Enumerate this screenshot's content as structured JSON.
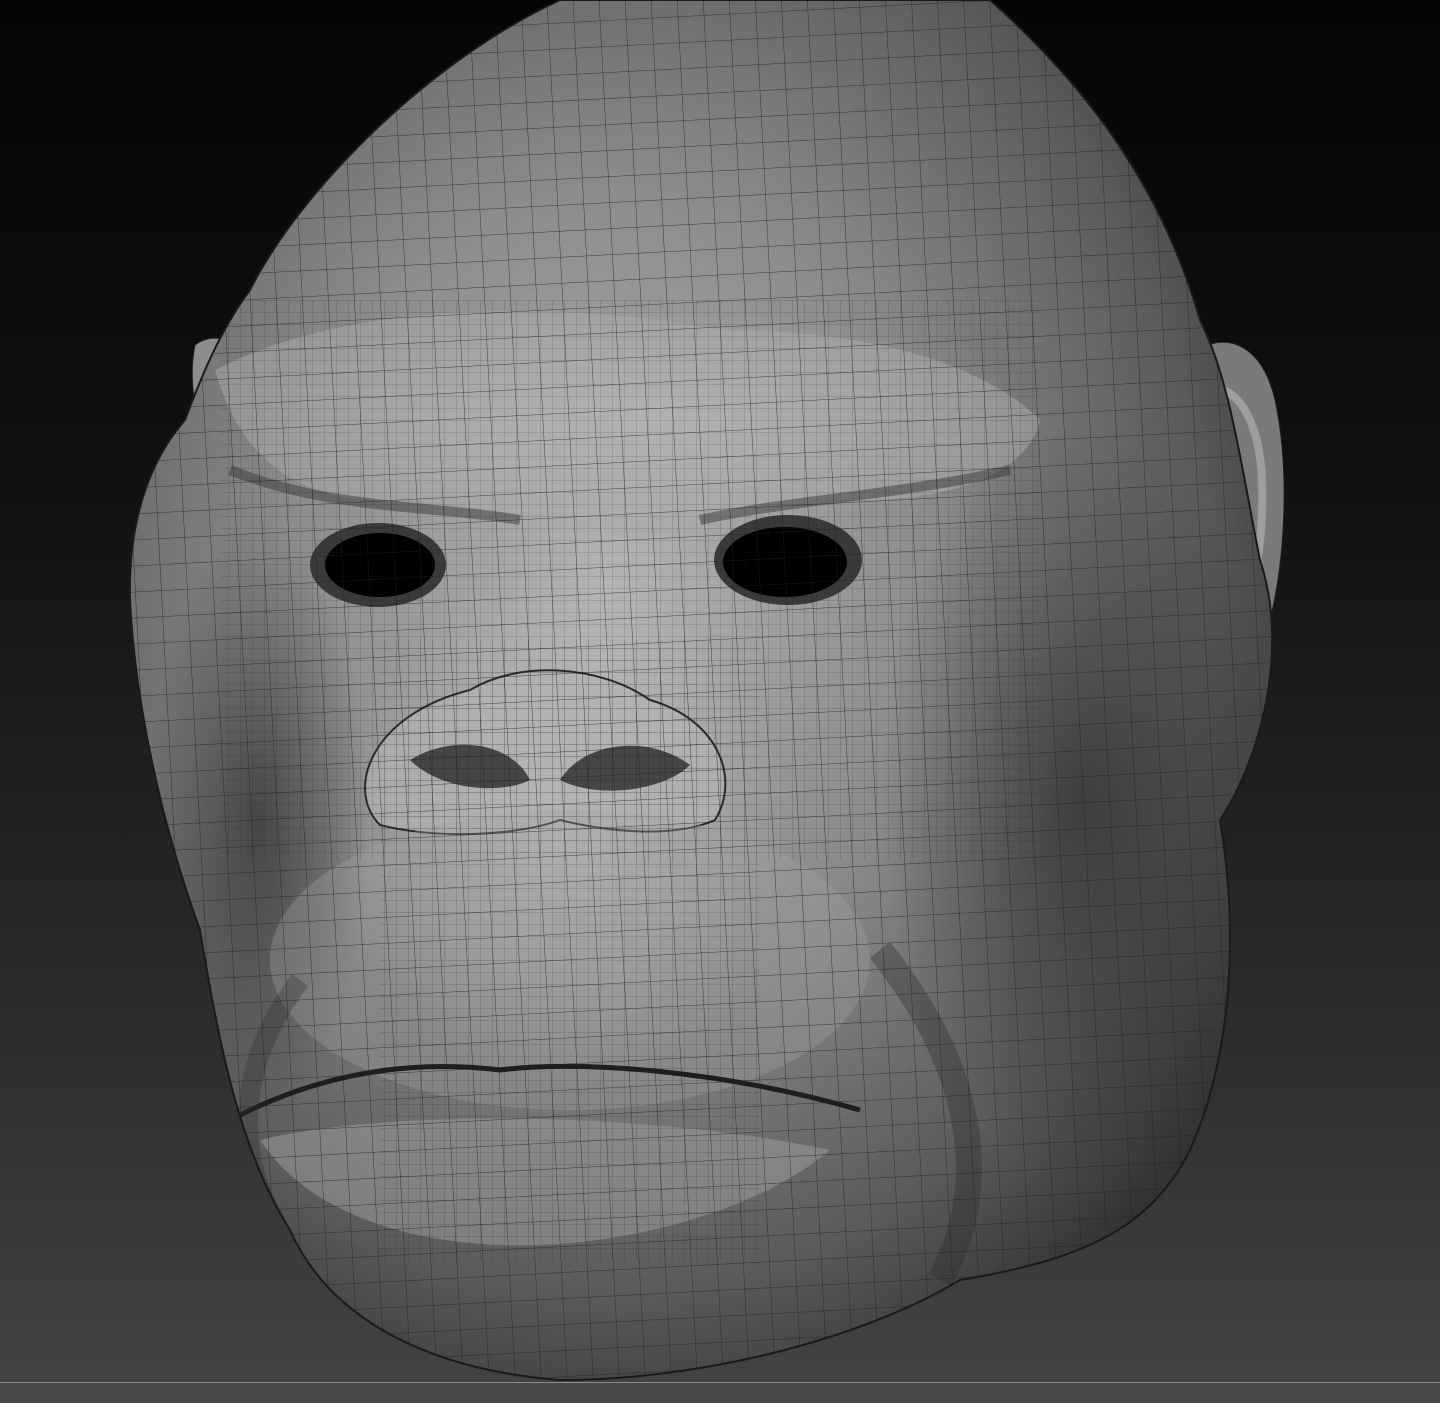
{
  "canvas": {
    "background_top": "#050505",
    "background_bottom": "#444444",
    "model_base_color": "#6b6b6b",
    "model_highlight_color": "#bdbdbd",
    "wireframe_color": "#1e1e1e"
  },
  "model": {
    "icon": "sculpt-mesh-icon"
  }
}
